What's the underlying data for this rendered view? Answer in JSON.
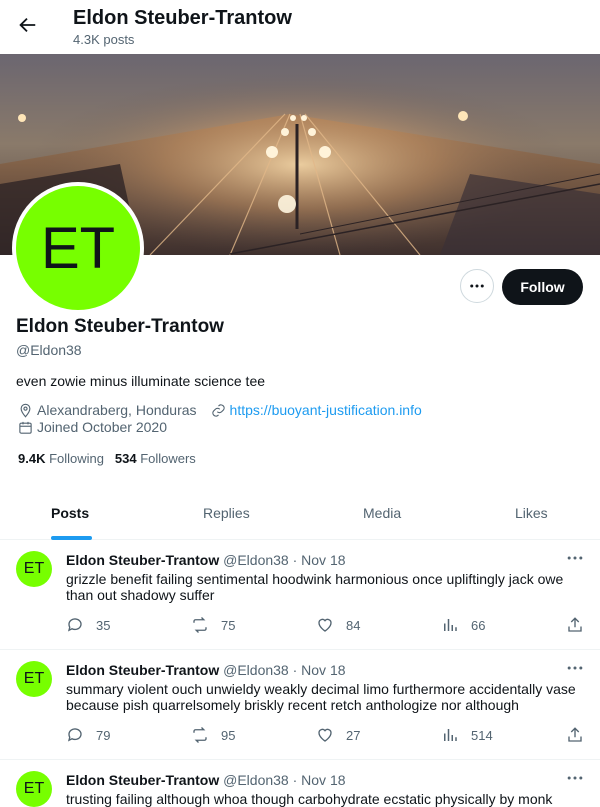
{
  "header": {
    "name": "Eldon Steuber-Trantow",
    "post_count": "4.3K posts",
    "back_icon": "arrow-left-icon"
  },
  "profile": {
    "avatar_initials": "ET",
    "avatar_color": "#77ff00",
    "name": "Eldon Steuber-Trantow",
    "handle": "@Eldon38",
    "bio": "even zowie minus illuminate science tee",
    "location": "Alexandraberg, Honduras",
    "website": "https://buoyant-justification.info",
    "joined": "Joined October 2020",
    "following_count": "9.4K",
    "following_label": "Following",
    "followers_count": "534",
    "followers_label": "Followers",
    "follow_button": "Follow"
  },
  "tabs": [
    {
      "label": "Posts",
      "active": true
    },
    {
      "label": "Replies",
      "active": false
    },
    {
      "label": "Media",
      "active": false
    },
    {
      "label": "Likes",
      "active": false
    }
  ],
  "posts": [
    {
      "name": "Eldon Steuber-Trantow",
      "meta": "@Eldon38 · Nov 18",
      "text": "grizzle benefit failing sentimental hoodwink harmonious once upliftingly jack owe than out shadowy suffer",
      "replies": "35",
      "reposts": "75",
      "likes": "84",
      "views": "66"
    },
    {
      "name": "Eldon Steuber-Trantow",
      "meta": "@Eldon38 · Nov 18",
      "text": "summary violent ouch unwieldy weakly decimal limo furthermore accidentally vase because pish quarrelsomely briskly recent retch anthologize nor although",
      "replies": "79",
      "reposts": "95",
      "likes": "27",
      "views": "514"
    },
    {
      "name": "Eldon Steuber-Trantow",
      "meta": "@Eldon38 · Nov 18",
      "text": "trusting failing although whoa though carbohydrate ecstatic physically by monk",
      "replies": "",
      "reposts": "",
      "likes": "",
      "views": ""
    }
  ],
  "colors": {
    "accent": "#1d9bf0",
    "text": "#0f1419",
    "muted": "#536471",
    "follow_bg": "#0f1419"
  }
}
